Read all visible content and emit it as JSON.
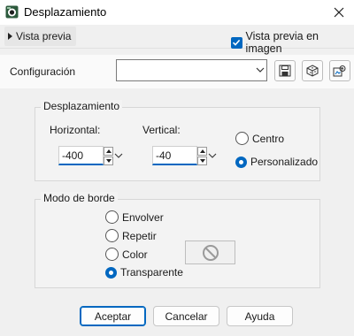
{
  "window": {
    "title": "Desplazamiento",
    "icon": "app-icon",
    "close_icon": "close-icon"
  },
  "preview": {
    "toggle_label": "Vista previa",
    "checkbox_label": "Vista previa en imagen",
    "checkbox_checked": true
  },
  "config": {
    "label": "Configuración",
    "value": "",
    "buttons": [
      "save-icon",
      "random-icon",
      "preset-icon"
    ]
  },
  "displacement": {
    "group_title": "Desplazamiento",
    "horizontal": {
      "label": "Horizontal:",
      "value": "-400"
    },
    "vertical": {
      "label": "Vertical:",
      "value": "-40"
    },
    "options": [
      {
        "label": "Centro",
        "selected": false
      },
      {
        "label": "Personalizado",
        "selected": true
      }
    ]
  },
  "edge_mode": {
    "group_title": "Modo de borde",
    "options": [
      {
        "label": "Envolver",
        "selected": false
      },
      {
        "label": "Repetir",
        "selected": false
      },
      {
        "label": "Color",
        "selected": false
      },
      {
        "label": "Transparente",
        "selected": true
      }
    ],
    "color_swatch_icon": "no-color-icon"
  },
  "buttons": {
    "ok": "Aceptar",
    "cancel": "Cancelar",
    "help": "Ayuda"
  },
  "colors": {
    "accent": "#0067c0",
    "background": "#f0f0f0"
  }
}
